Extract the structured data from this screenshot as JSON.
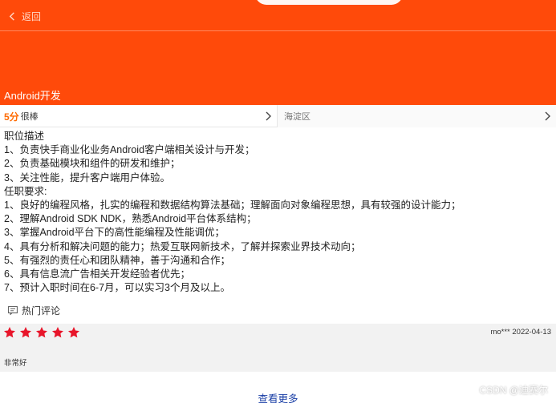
{
  "header": {
    "back_label": "返回",
    "job_title": "Android开发",
    "bg_color": "#ff4a0a"
  },
  "info": {
    "score": "5分",
    "score_label": "很棒",
    "location": "海淀区"
  },
  "description_lines": [
    "职位描述",
    "1、负责快手商业化业务Android客户端相关设计与开发；",
    "2、负责基础模块和组件的研发和维护；",
    "3、关注性能，提升客户端用户体验。",
    "任职要求:",
    "1、良好的编程风格，扎实的编程和数据结构算法基础；理解面向对象编程思想，具有较强的设计能力；",
    "2、理解Android SDK NDK，熟悉Android平台体系结构；",
    "3、掌握Android平台下的高性能编程及性能调优；",
    "4、具有分析和解决问题的能力；热爱互联网新技术，了解并探索业界技术动向；",
    "5、有强烈的责任心和团队精神，善于沟通和合作；",
    "6、具有信息流广告相关开发经验者优先；",
    "7、预计入职时间在6-7月，可以实习3个月及以上。"
  ],
  "comments": {
    "section_label": "热门评论",
    "review": {
      "rating": 5,
      "reviewer_date": "mo*** 2022-04-13",
      "text": "非常好",
      "star_color": "#e8152a"
    },
    "more_label": "查看更多"
  },
  "watermark": "CSDN @迪赛尔",
  "icons": [
    "chevron-left-icon",
    "chevron-right-icon",
    "comment-icon",
    "star-icon"
  ]
}
